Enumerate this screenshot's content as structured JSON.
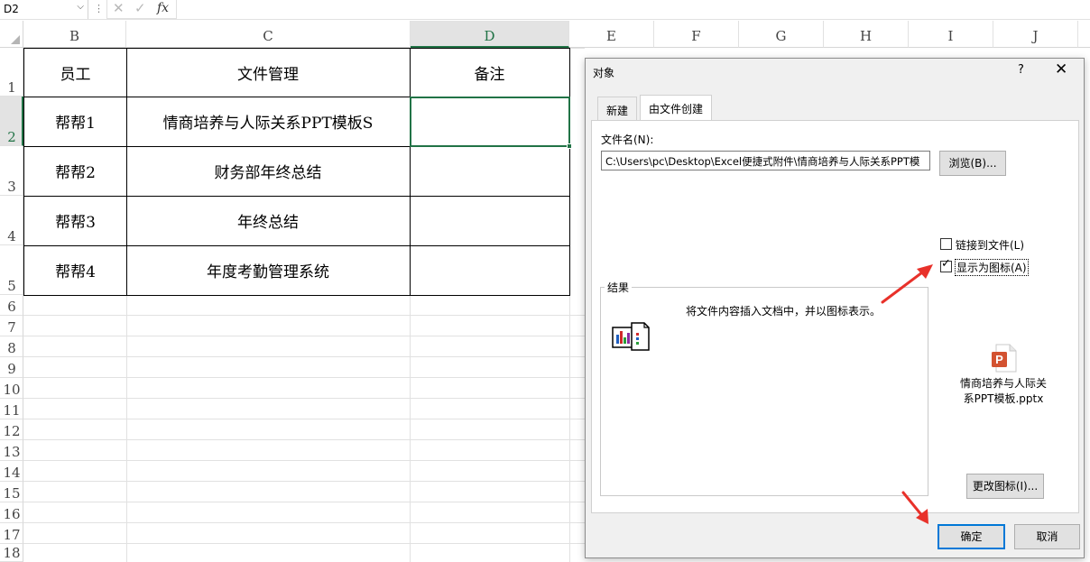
{
  "formula_bar": {
    "name_box": "D2",
    "cancel_icon": "close-icon",
    "enter_icon": "check-icon",
    "fx_label": "fx",
    "formula": ""
  },
  "columns": [
    "B",
    "C",
    "D",
    "E",
    "F",
    "G",
    "H",
    "I",
    "J"
  ],
  "rows": [
    "1",
    "2",
    "3",
    "4",
    "5",
    "6",
    "7",
    "8",
    "9",
    "10",
    "11",
    "12",
    "13",
    "14",
    "15",
    "16",
    "17",
    "18"
  ],
  "table": {
    "headers": [
      "员工",
      "文件管理",
      "备注"
    ],
    "rows": [
      {
        "employee": "帮帮1",
        "file": "情商培养与人际关系PPT模板S",
        "note": ""
      },
      {
        "employee": "帮帮2",
        "file": "财务部年终总结",
        "note": ""
      },
      {
        "employee": "帮帮3",
        "file": "年终总结",
        "note": ""
      },
      {
        "employee": "帮帮4",
        "file": "年度考勤管理系统",
        "note": ""
      }
    ]
  },
  "dialog": {
    "title": "对象",
    "help": "?",
    "close": "✕",
    "tabs": [
      "新建",
      "由文件创建"
    ],
    "active_tab": "由文件创建",
    "filename_label": "文件名(N):",
    "filename_value": "C:\\Users\\pc\\Desktop\\Excel便捷式附件\\情商培养与人际关系PPT模",
    "browse_button": "浏览(B)...",
    "link_checkbox": {
      "label": "链接到文件(L)",
      "checked": false
    },
    "icon_checkbox": {
      "label": "显示为图标(A)",
      "checked": true
    },
    "result_legend": "结果",
    "result_text": "将文件内容插入文档中，并以图标表示。",
    "icon_caption_line1": "情商培养与人际关",
    "icon_caption_line2": "系PPT模板.pptx",
    "pptx_glyph": "P",
    "change_icon_button": "更改图标(I)...",
    "ok_button": "确定",
    "cancel_button": "取消"
  },
  "colors": {
    "excel_green": "#217346",
    "annotation_arrow": "#e8312a",
    "ok_border": "#0078d7",
    "pptx_orange": "#d35230"
  }
}
